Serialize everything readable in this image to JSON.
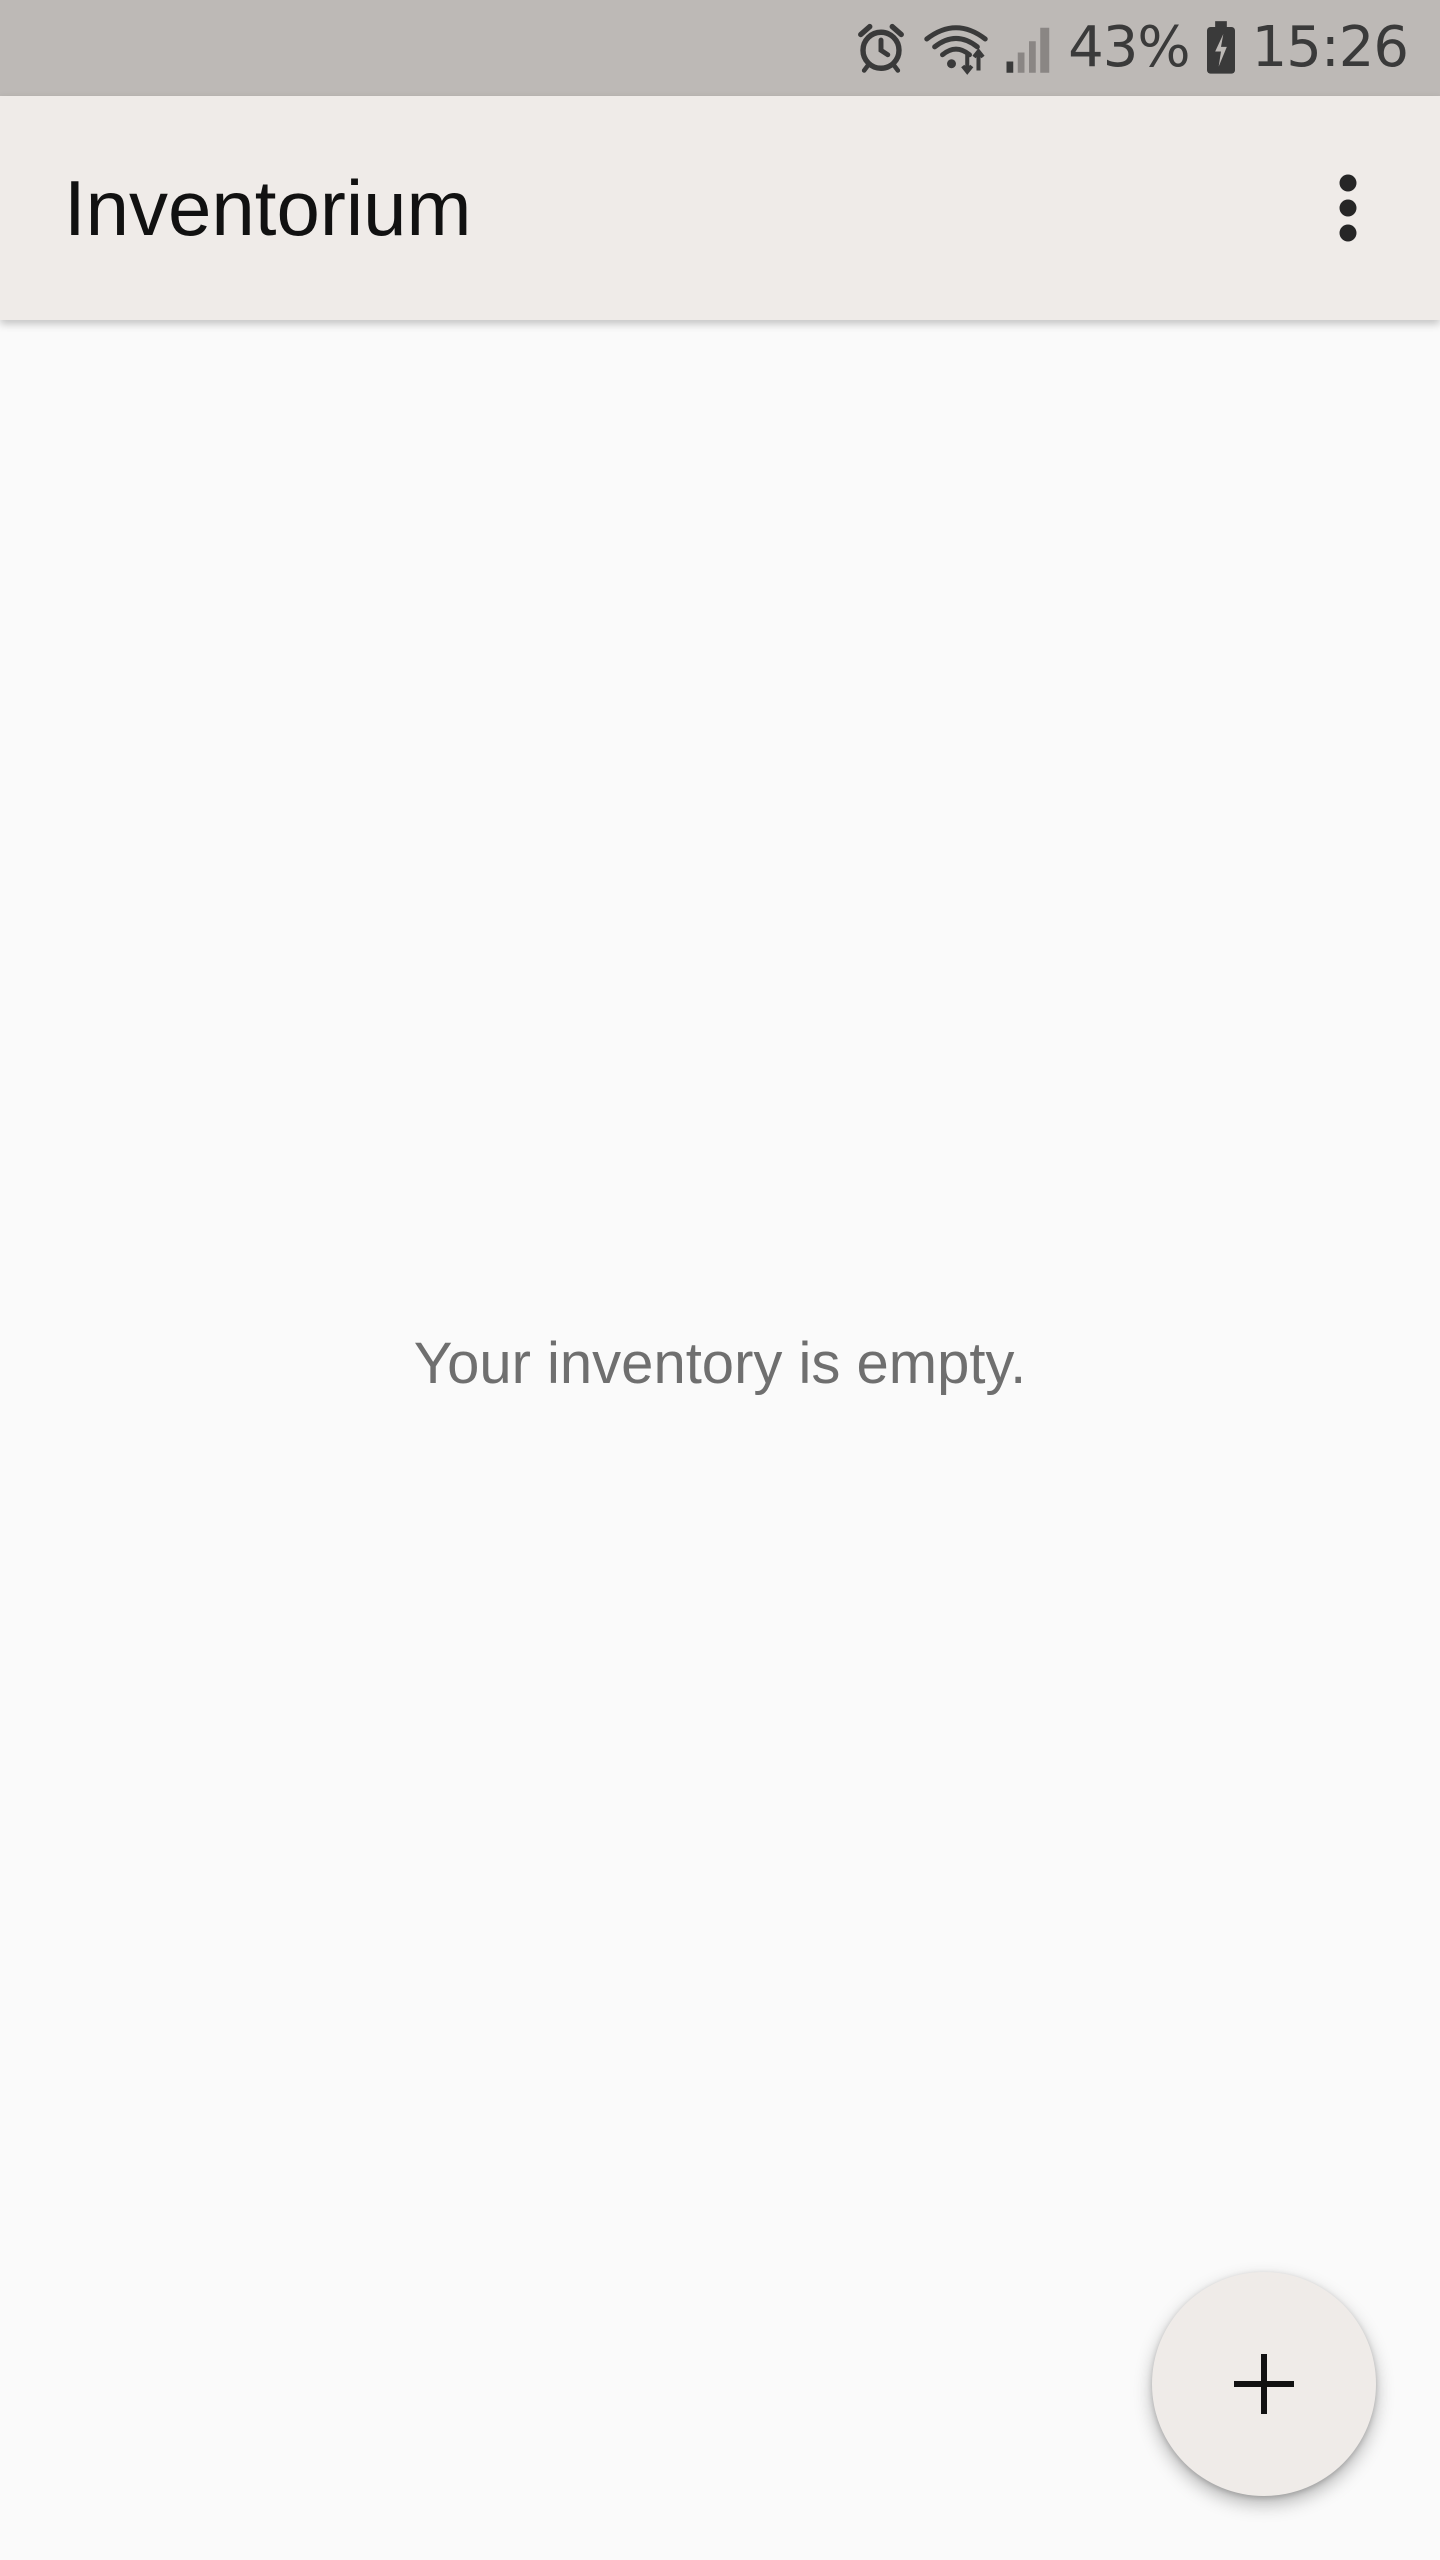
{
  "status_bar": {
    "battery_percent": "43%",
    "time": "15:26",
    "icons": [
      "alarm-icon",
      "wifi-icon",
      "signal-icon",
      "battery-charging-icon"
    ]
  },
  "app_bar": {
    "title": "Inventorium",
    "overflow_icon": "more-vert-icon",
    "background": "#efebe8"
  },
  "content": {
    "empty_message": "Your inventory is empty."
  },
  "fab": {
    "icon": "add-icon",
    "background": "#efebe8"
  },
  "colors": {
    "status_bar": "#bdb9b6",
    "page_background": "#fafafa",
    "empty_text": "#6f6f6f"
  }
}
